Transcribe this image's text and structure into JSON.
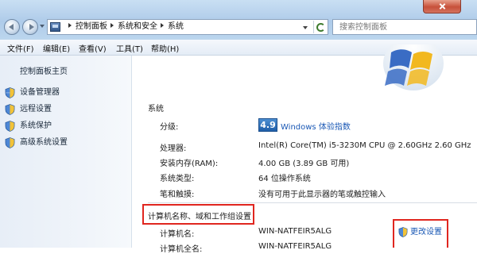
{
  "address_bar": {
    "crumbs": [
      "控制面板",
      "系统和安全",
      "系统"
    ]
  },
  "search": {
    "placeholder": "搜索控制面板"
  },
  "menu": {
    "file": "文件(F)",
    "edit": "编辑(E)",
    "view": "查看(V)",
    "tools": "工具(T)",
    "help": "帮助(H)"
  },
  "sidebar": {
    "home": "控制面板主页",
    "items": [
      {
        "label": "设备管理器",
        "icon": "uac-shield-icon"
      },
      {
        "label": "远程设置",
        "icon": "uac-shield-icon"
      },
      {
        "label": "系统保护",
        "icon": "uac-shield-icon"
      },
      {
        "label": "高级系统设置",
        "icon": "uac-shield-icon"
      }
    ]
  },
  "system": {
    "heading": "系统",
    "rating_label": "分级:",
    "rating_score": "4.9",
    "rating_link": "Windows 体验指数",
    "rows": [
      {
        "label": "处理器:",
        "value": "Intel(R) Core(TM) i5-3230M CPU @ 2.60GHz   2.60 GHz"
      },
      {
        "label": "安装内存(RAM):",
        "value": "4.00 GB (3.89 GB 可用)"
      },
      {
        "label": "系统类型:",
        "value": "64 位操作系统"
      },
      {
        "label": "笔和触摸:",
        "value": "没有可用于此显示器的笔或触控输入"
      }
    ]
  },
  "computer": {
    "heading": "计算机名称、域和工作组设置",
    "rows": [
      {
        "label": "计算机名:",
        "value": "WIN-NATFEIR5ALG"
      },
      {
        "label": "计算机全名:",
        "value": "WIN-NATFEIR5ALG"
      }
    ],
    "change_settings": "更改设置"
  },
  "colors": {
    "link": "#1a58b5",
    "highlight": "#e0261f",
    "titlebar": "#aecbe9"
  }
}
